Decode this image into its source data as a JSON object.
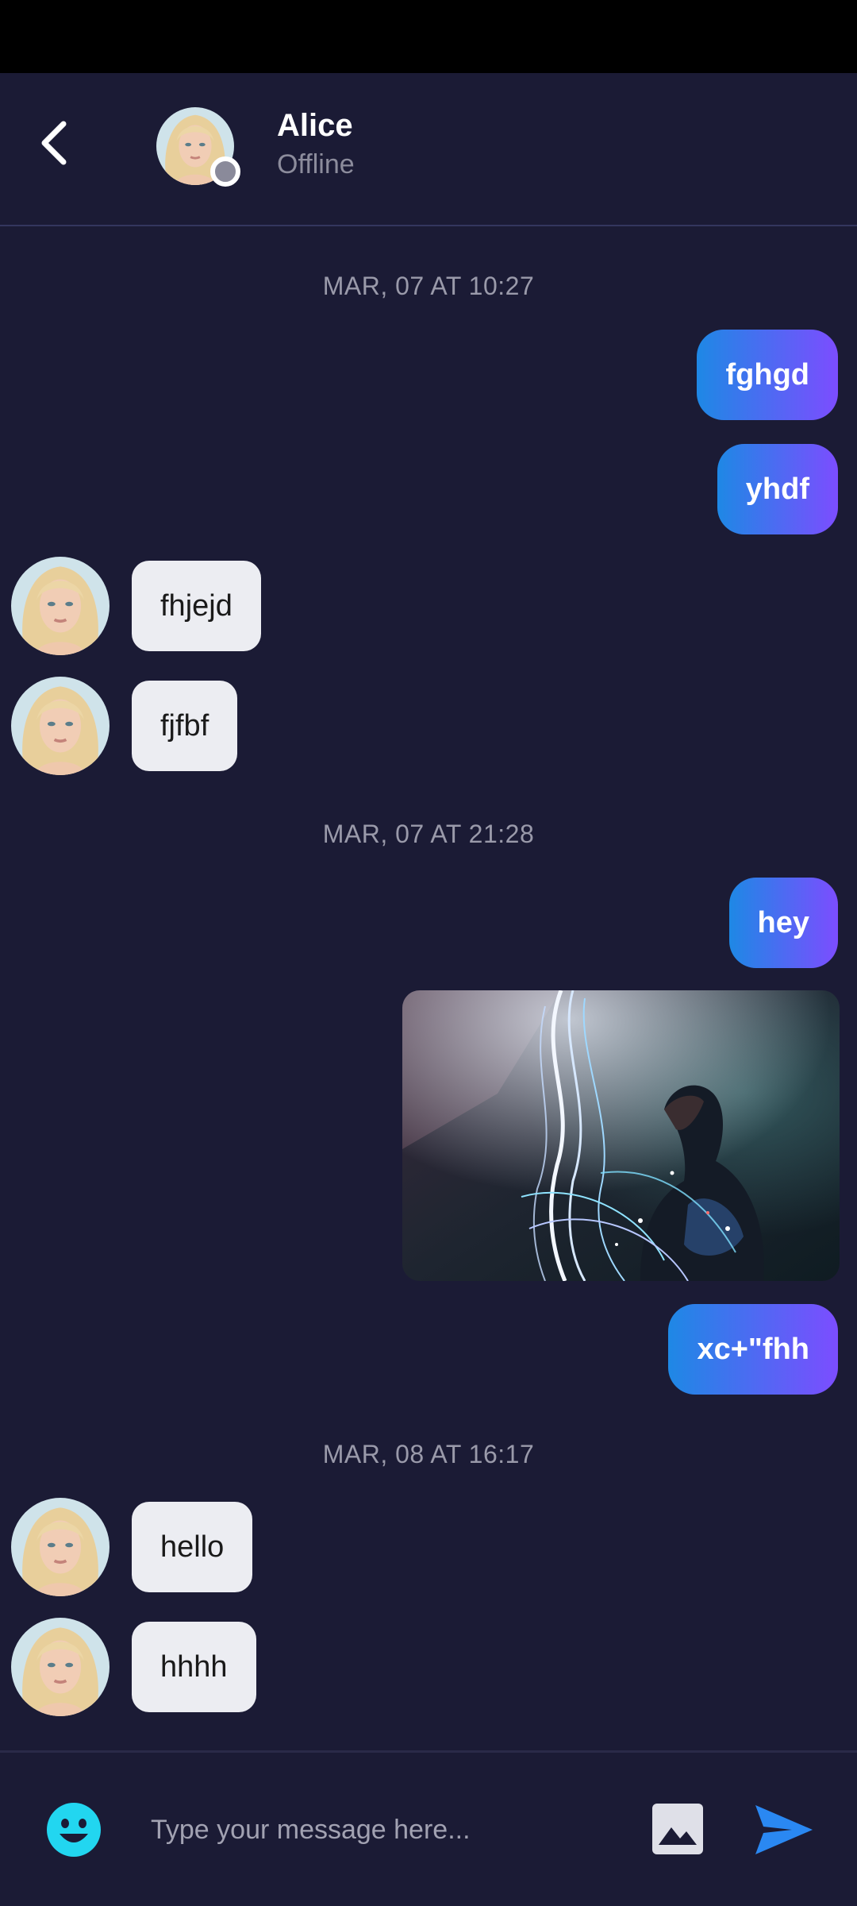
{
  "contact": {
    "name": "Alice",
    "status": "Offline"
  },
  "colors": {
    "background": "#1b1b35",
    "outgoing_gradient_start": "#1e88e5",
    "outgoing_gradient_end": "#7c4dff",
    "incoming_bubble": "#ecedf2",
    "emoji_icon": "#22d6f0",
    "send_icon": "#2a88f2"
  },
  "conversation": [
    {
      "timestamp": "MAR, 07 AT 10:27"
    },
    {
      "timestamp": "MAR, 07 AT 21:28"
    },
    {
      "timestamp": "MAR, 08 AT 16:17"
    }
  ],
  "messages": {
    "m1": "fghgd",
    "m2": "yhdf",
    "m3": "fhjejd",
    "m4": "fjfbf",
    "m5": "hey",
    "m7": "xc+\"fhh",
    "m8": "hello",
    "m9": "hhhh"
  },
  "composer": {
    "placeholder": "Type your message here...",
    "icons": [
      "emoji-icon",
      "image-icon",
      "send-icon"
    ]
  }
}
